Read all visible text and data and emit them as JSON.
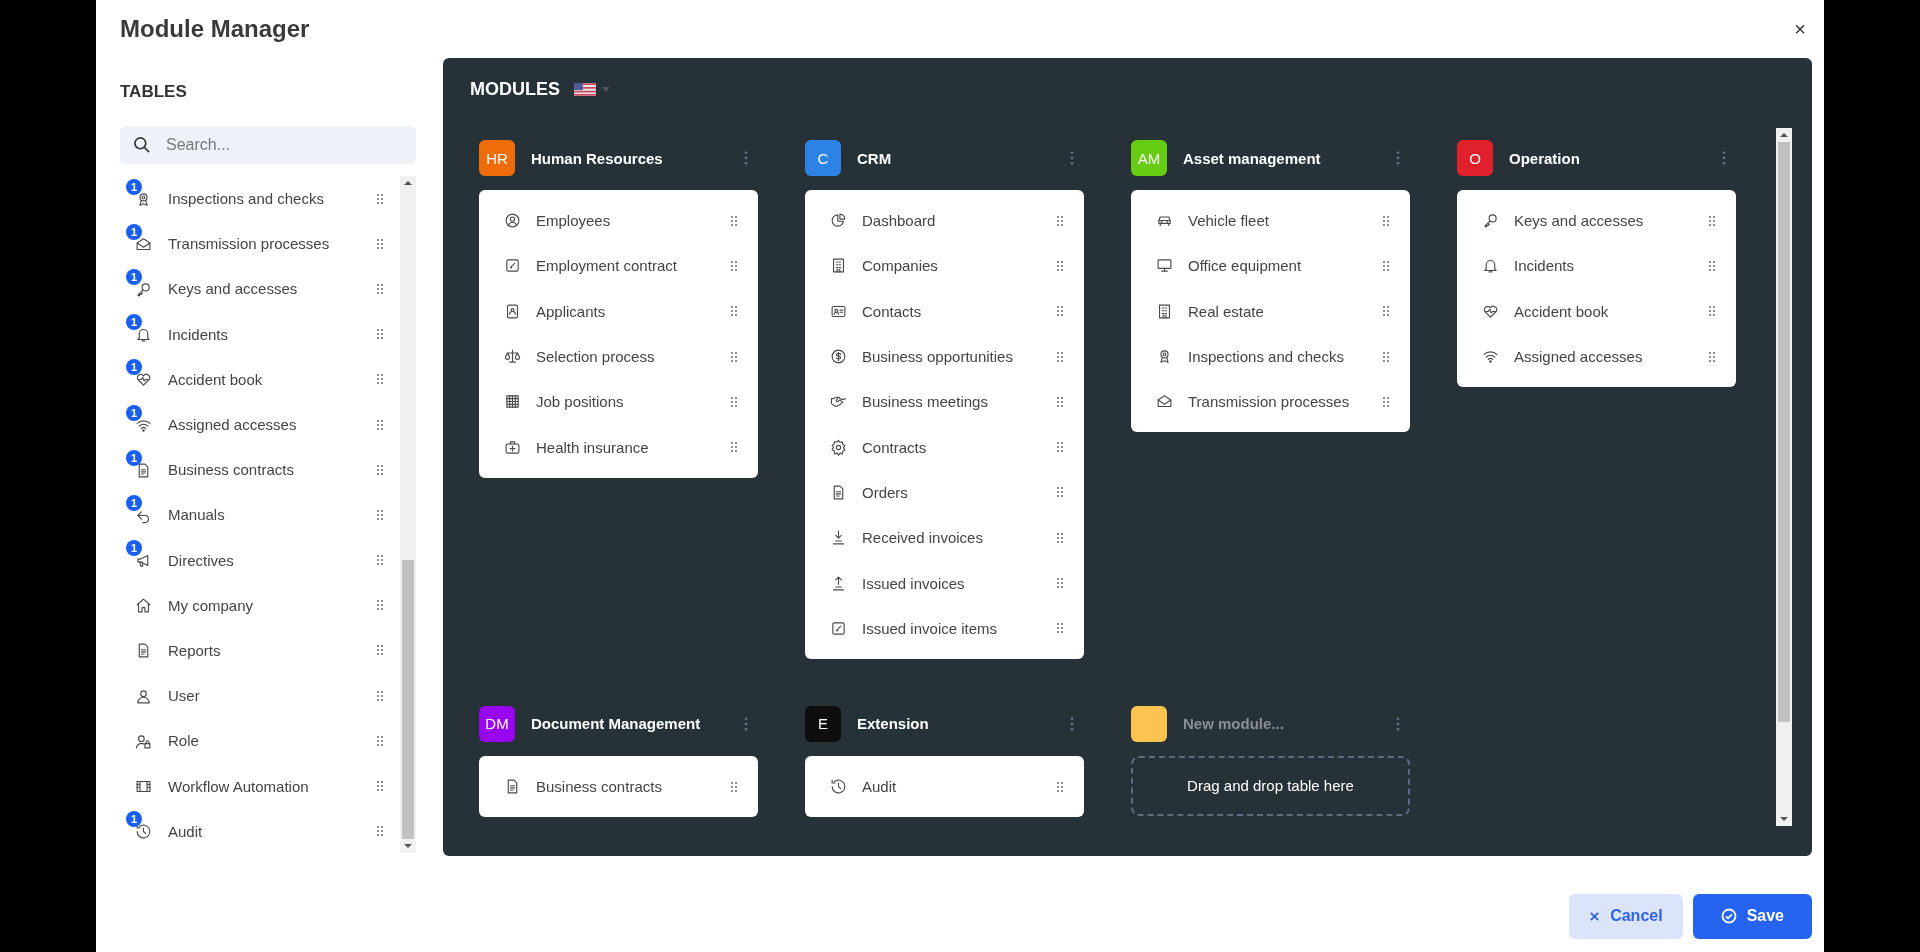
{
  "dialog": {
    "title": "Module Manager",
    "close": "×"
  },
  "sidebar": {
    "title": "TABLES",
    "search": {
      "placeholder": "Search..."
    },
    "items": [
      {
        "label": "Inspections and checks",
        "count": "1"
      },
      {
        "label": "Transmission processes",
        "count": "1"
      },
      {
        "label": "Keys and accesses",
        "count": "1"
      },
      {
        "label": "Incidents",
        "count": "1"
      },
      {
        "label": "Accident book",
        "count": "1"
      },
      {
        "label": "Assigned accesses",
        "count": "1"
      },
      {
        "label": "Business contracts",
        "count": "1"
      },
      {
        "label": "Manuals",
        "count": "1"
      },
      {
        "label": "Directives",
        "count": "1"
      },
      {
        "label": "My company"
      },
      {
        "label": "Reports"
      },
      {
        "label": "User"
      },
      {
        "label": "Role"
      },
      {
        "label": "Workflow Automation"
      },
      {
        "label": "Audit",
        "count": "1"
      }
    ]
  },
  "modules_panel": {
    "title": "MODULES",
    "modules": [
      {
        "kind": "module",
        "badge": "HR",
        "color": "#ef6c0a",
        "title": "Human Resources",
        "items": [
          "Employees",
          "Employment contract",
          "Applicants",
          "Selection process",
          "Job positions",
          "Health insurance"
        ]
      },
      {
        "kind": "module",
        "badge": "C",
        "color": "#2d82e6",
        "title": "CRM",
        "items": [
          "Dashboard",
          "Companies",
          "Contacts",
          "Business opportunities",
          "Business meetings",
          "Contracts",
          "Orders",
          "Received invoices",
          "Issued invoices",
          "Issued invoice items"
        ]
      },
      {
        "kind": "module",
        "badge": "AM",
        "color": "#66cc14",
        "title": "Asset management",
        "items": [
          "Vehicle fleet",
          "Office equipment",
          "Real estate",
          "Inspections and checks",
          "Transmission processes"
        ]
      },
      {
        "kind": "module",
        "badge": "O",
        "color": "#e0202a",
        "title": "Operation",
        "items": [
          "Keys and accesses",
          "Incidents",
          "Accident book",
          "Assigned accesses"
        ]
      },
      {
        "kind": "module",
        "badge": "DM",
        "color": "#9a05f0",
        "title": "Document Management",
        "items": [
          "Business contracts"
        ]
      },
      {
        "kind": "module",
        "badge": "E",
        "color": "#0d0d0d",
        "title": "Extension",
        "items": [
          "Audit"
        ]
      },
      {
        "kind": "new",
        "color": "#fbc34f",
        "title": "New module...",
        "dropzone": "Drag and drop table here"
      }
    ]
  },
  "footer": {
    "cancel": "Cancel",
    "save": "Save"
  }
}
